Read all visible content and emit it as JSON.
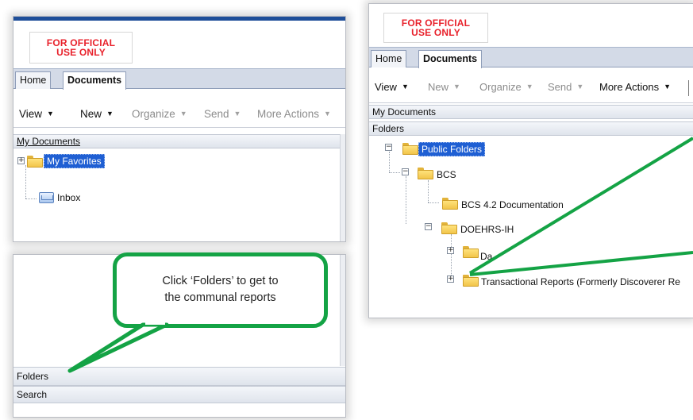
{
  "left_panel": {
    "logo_line1": "FOR OFFICIAL",
    "logo_line2": "USE ONLY",
    "tabs": [
      {
        "label": "Home",
        "active": false
      },
      {
        "label": "Documents",
        "active": true
      }
    ],
    "toolbar": {
      "view": "View",
      "new": "New",
      "organize": "Organize",
      "send": "Send",
      "more_actions": "More Actions"
    },
    "my_documents_header": "My Documents",
    "tree": {
      "favorites": "My Favorites",
      "inbox": "Inbox"
    },
    "bottom_bars": {
      "folders": "Folders",
      "search": "Search"
    }
  },
  "callout": {
    "line1": "Click ‘Folders’ to get to",
    "line2": "the communal reports"
  },
  "right_panel": {
    "logo_line1": "FOR OFFICIAL",
    "logo_line2": "USE ONLY",
    "tabs": [
      {
        "label": "Home",
        "active": false
      },
      {
        "label": "Documents",
        "active": true
      }
    ],
    "toolbar": {
      "view": "View",
      "new": "New",
      "organize": "Organize",
      "send": "Send",
      "more_actions": "More Actions"
    },
    "my_documents_bar": "My Documents",
    "folders_bar": "Folders",
    "tree": {
      "public_folders": "Public Folders",
      "bcs": "BCS",
      "bcs_doc": "BCS 4.2 Documentation",
      "doehrs": "DOEHRS-IH",
      "truncated": "Da",
      "transactional": "Transactional Reports (Formerly Discoverer Re"
    }
  },
  "colors": {
    "callout_green": "#14a345",
    "selection_blue": "#1f5fd3",
    "logo_red": "#e8212b",
    "tab_strip": "#d3dae7"
  }
}
